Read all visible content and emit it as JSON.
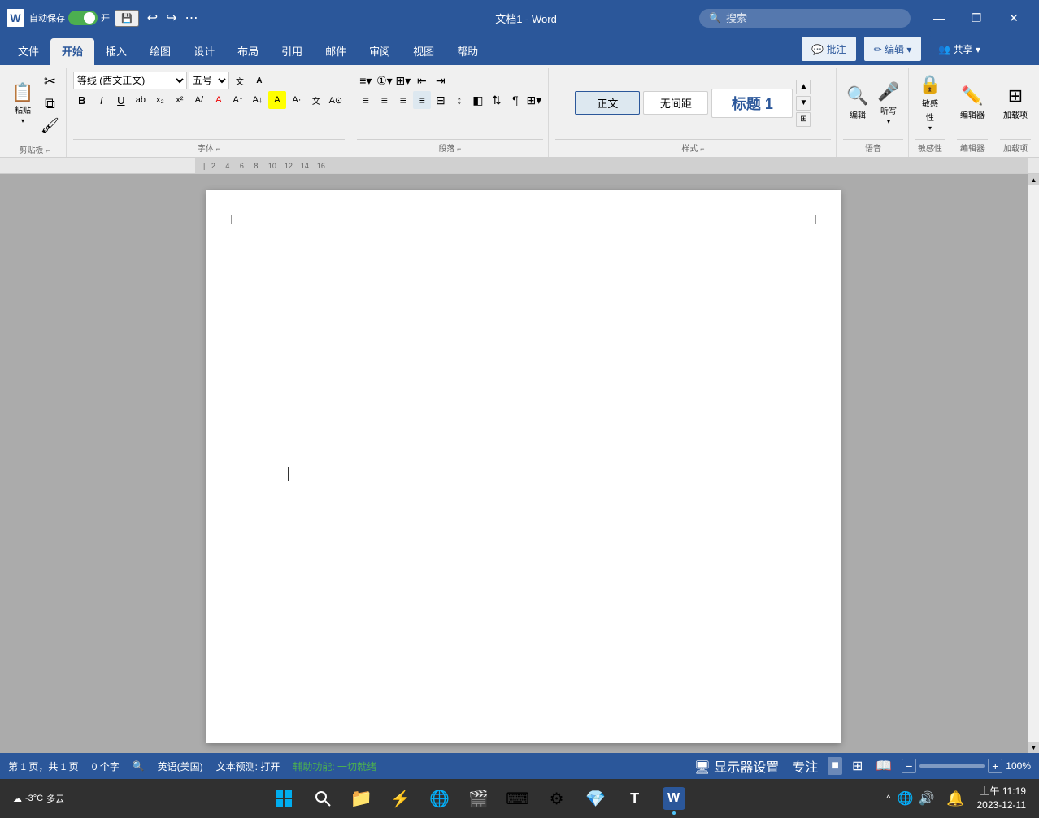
{
  "titleBar": {
    "appIcon": "W",
    "autosave": "自动保存",
    "autosaveState": "开",
    "saveIcon": "💾",
    "undoIcon": "↩",
    "redoIcon": "↪",
    "extraMenuIcon": "⋯",
    "title": "文档1 - Word",
    "searchPlaceholder": "搜索",
    "helpIcon": "?",
    "minimizeIcon": "—",
    "restoreIcon": "❐",
    "closeIcon": "✕"
  },
  "ribbonTabs": [
    "文件",
    "开始",
    "插入",
    "绘图",
    "设计",
    "布局",
    "引用",
    "邮件",
    "审阅",
    "视图",
    "帮助"
  ],
  "activeTab": "开始",
  "ribbon": {
    "groups": [
      {
        "label": "剪贴板",
        "id": "clipboard"
      },
      {
        "label": "字体",
        "id": "font"
      },
      {
        "label": "段落",
        "id": "paragraph"
      },
      {
        "label": "样式",
        "id": "styles"
      },
      {
        "label": "语音",
        "id": "voice"
      },
      {
        "label": "敏感性",
        "id": "sensitivity"
      },
      {
        "label": "编辑器",
        "id": "editor"
      },
      {
        "label": "加载项",
        "id": "addins"
      }
    ],
    "fontName": "等线 (西文正文)",
    "fontSize": "五号",
    "reviewBtn": "批注",
    "editBtn": "编辑",
    "shareBtn": "共享"
  },
  "styles": [
    {
      "label": "正文",
      "id": "normal",
      "active": true
    },
    {
      "label": "无间距",
      "id": "no-space",
      "active": false
    },
    {
      "label": "标题 1",
      "id": "heading1",
      "active": false,
      "large": true
    }
  ],
  "statusBar": {
    "pageInfo": "第 1 页，共 1 页",
    "wordCount": "0 个字",
    "proofIcon": "🔍",
    "lang": "英语(美国)",
    "textPrediction": "文本预测: 打开",
    "accessibility": "辅助功能: 一切就绪",
    "displaySettings": "显示器设置",
    "focus": "专注",
    "viewNormal": "■",
    "viewWeb": "⊞",
    "viewRead": "📖",
    "zoomMinus": "−",
    "zoomPlus": "+",
    "zoomLevel": "100%"
  },
  "taskbar": {
    "startIcon": "⊞",
    "searchPlaceholder": "搜索",
    "weatherTemp": "-3°C",
    "weatherDesc": "多云",
    "time": "上午 11:19",
    "date": "2023-12-11",
    "notifyIcon": "🔔",
    "apps": [
      {
        "icon": "⊞",
        "name": "start",
        "active": false
      },
      {
        "icon": "🔍",
        "name": "search",
        "active": false
      },
      {
        "icon": "📁",
        "name": "explorer",
        "active": false
      },
      {
        "icon": "⚡",
        "name": "vscode",
        "active": false
      },
      {
        "icon": "🌐",
        "name": "edge",
        "active": false
      },
      {
        "icon": "🎬",
        "name": "media",
        "active": false
      },
      {
        "icon": "⌨",
        "name": "input",
        "active": false
      },
      {
        "icon": "⚙",
        "name": "settings",
        "active": false
      },
      {
        "icon": "💎",
        "name": "app1",
        "active": false
      },
      {
        "icon": "T",
        "name": "typora",
        "active": false
      },
      {
        "icon": "W",
        "name": "word",
        "active": true
      }
    ]
  }
}
